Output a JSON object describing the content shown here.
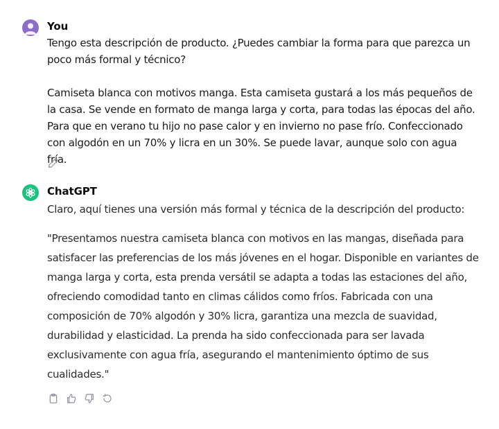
{
  "user_message": {
    "author": "You",
    "paragraphs": [
      "Tengo esta descripción de producto. ¿Puedes cambiar la forma para que parezca un poco más formal y técnico?",
      "Camiseta blanca con motivos manga. Esta camiseta gustará a los más pequeños de la casa. Se vende en formato de manga larga y corta, para todas las épocas del año. Para que en verano tu hijo no pase calor y en invierno no pase frío. Confeccionado con algodón en un 70% y licra en un 30%. Se puede lavar, aunque solo con agua fría."
    ],
    "edit_icon": "pencil-icon",
    "avatar_color": "#8e6cc9"
  },
  "assistant_message": {
    "author": "ChatGPT",
    "paragraphs": [
      "Claro, aquí tienes una versión más formal y técnica de la descripción del producto:",
      "\"Presentamos nuestra camiseta blanca con motivos en las mangas, diseñada para satisfacer las preferencias de los más jóvenes en el hogar. Disponible en variantes de manga larga y corta, esta prenda versátil se adapta a todas las estaciones del año, ofreciendo comodidad tanto en climas cálidos como fríos. Fabricada con una composición de 70% algodón y 30% licra, garantiza una mezcla de suavidad, durabilidad y elasticidad. La prenda ha sido confeccionada para ser lavada exclusivamente con agua fría, asegurando el mantenimiento óptimo de sus cualidades.\""
    ],
    "avatar_color": "#19c37d",
    "actions": [
      "clipboard-icon",
      "thumbs-up-icon",
      "thumbs-down-icon",
      "regenerate-icon"
    ]
  }
}
